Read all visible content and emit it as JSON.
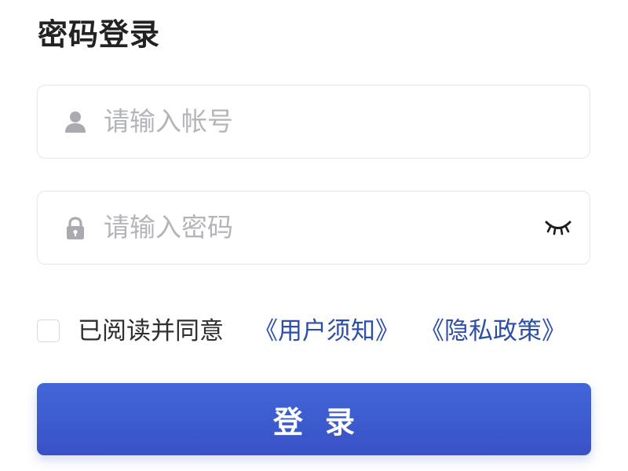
{
  "page": {
    "title": "密码登录"
  },
  "account": {
    "placeholder": "请输入帐号",
    "value": "",
    "icon": "user-icon"
  },
  "password": {
    "placeholder": "请输入密码",
    "value": "",
    "icon": "lock-icon",
    "toggle_icon": "eye-closed-icon"
  },
  "agreement": {
    "checked": false,
    "text": "已阅读并同意",
    "terms_link": "《用户须知》",
    "privacy_link": "《隐私政策》"
  },
  "login_button": {
    "label": "登录"
  },
  "colors": {
    "accent": "#3a57c8",
    "link": "#2e4fa8",
    "icon": "#a9abb0",
    "border": "#e4e6ea",
    "placeholder": "#b3b5ba"
  }
}
